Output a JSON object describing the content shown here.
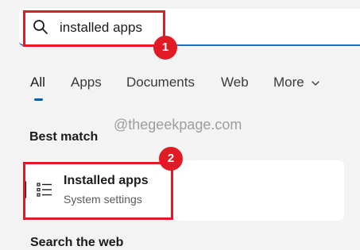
{
  "search": {
    "value": "installed apps",
    "icon": "search-icon"
  },
  "tabs": [
    {
      "label": "All"
    },
    {
      "label": "Apps"
    },
    {
      "label": "Documents"
    },
    {
      "label": "Web"
    },
    {
      "label": "More"
    }
  ],
  "watermark": "@thegeekpage.com",
  "best_match": {
    "header": "Best match",
    "result": {
      "title": "Installed apps",
      "subtitle": "System settings",
      "icon": "list-settings-icon"
    }
  },
  "search_web": {
    "header": "Search the web"
  },
  "annotations": {
    "step1": "1",
    "step2": "2",
    "color": "#e01b24"
  },
  "colors": {
    "accent": "#005fb8",
    "background": "#f3f3f3"
  }
}
